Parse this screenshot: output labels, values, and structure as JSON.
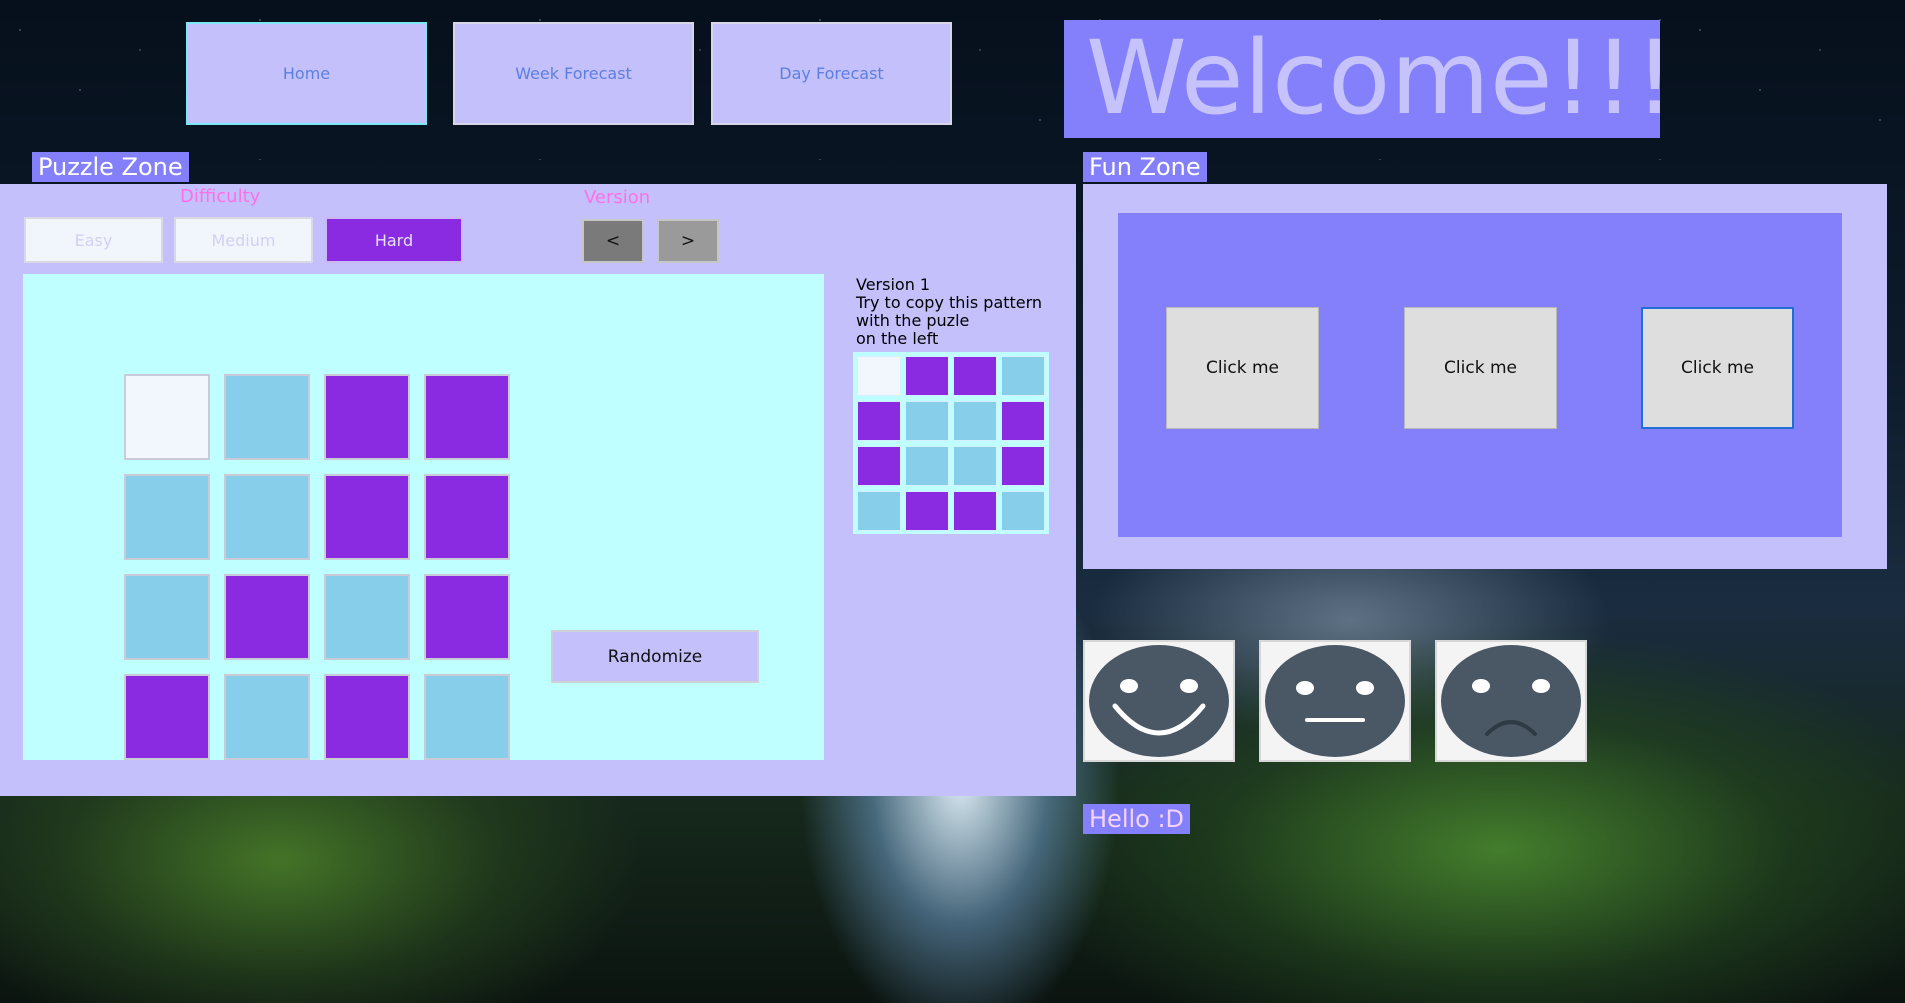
{
  "nav": {
    "home_label": "Home",
    "week_label": "Week Forecast",
    "day_label": "Day Forecast"
  },
  "welcome": "Welcome!!!",
  "puzzle_zone": {
    "title": "Puzzle Zone",
    "difficulty_label": "Difficulty",
    "version_label": "Version",
    "difficulty_options": [
      "Easy",
      "Medium",
      "Hard"
    ],
    "selected_difficulty": "Hard",
    "prev_label": "<",
    "next_label": ">",
    "version_title": "Version 1",
    "instructions": [
      "Try to copy this pattern",
      "with the puzle",
      "on the left"
    ],
    "randomize_label": "Randomize",
    "grid": [
      [
        "white",
        "blue",
        "purple",
        "purple"
      ],
      [
        "blue",
        "blue",
        "purple",
        "purple"
      ],
      [
        "blue",
        "purple",
        "blue",
        "purple"
      ],
      [
        "purple",
        "blue",
        "purple",
        "blue"
      ]
    ],
    "pattern": [
      [
        "white",
        "purple",
        "purple",
        "blue"
      ],
      [
        "purple",
        "blue",
        "blue",
        "purple"
      ],
      [
        "purple",
        "blue",
        "blue",
        "purple"
      ],
      [
        "blue",
        "purple",
        "purple",
        "blue"
      ]
    ]
  },
  "fun_zone": {
    "title": "Fun Zone",
    "buttons": [
      "Click me",
      "Click me",
      "Click me"
    ],
    "faces": [
      "happy-face-icon",
      "neutral-face-icon",
      "sad-face-icon"
    ],
    "greeting": "Hello :D"
  },
  "colors": {
    "accent": "#8480fc",
    "panel": "#c3c0fb",
    "tile_purple": "#8a2be2",
    "tile_blue": "#87ceeb",
    "tile_white": "#f1f7fd",
    "puzzle_bg": "#bfffff"
  }
}
